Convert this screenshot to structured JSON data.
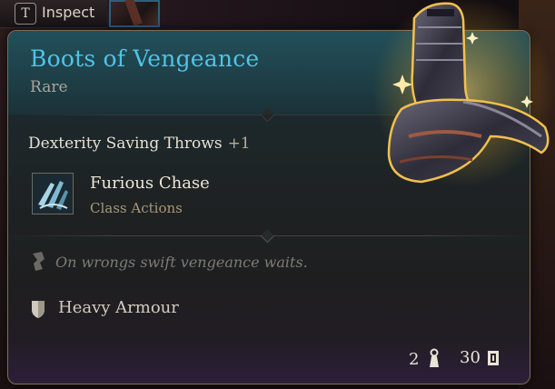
{
  "topbar": {
    "key": "T",
    "inspect_label": "Inspect"
  },
  "item": {
    "name": "Boots of Vengeance",
    "rarity": "Rare",
    "name_color": "#4fc3e6",
    "stat": {
      "label": "Dexterity Saving Throws",
      "bonus": "+1"
    },
    "action": {
      "name": "Furious Chase",
      "type": "Class Actions",
      "icon": "furious-chase-icon"
    },
    "flavor_text": "On wrongs swift vengeance waits.",
    "armour_type": "Heavy Armour",
    "weight": "2",
    "value": "30"
  },
  "icons": {
    "flavor": "quill-icon",
    "armour": "shield-icon",
    "weight": "weight-icon",
    "gold": "gold-coin-icon",
    "item_image": "boots-icon"
  }
}
